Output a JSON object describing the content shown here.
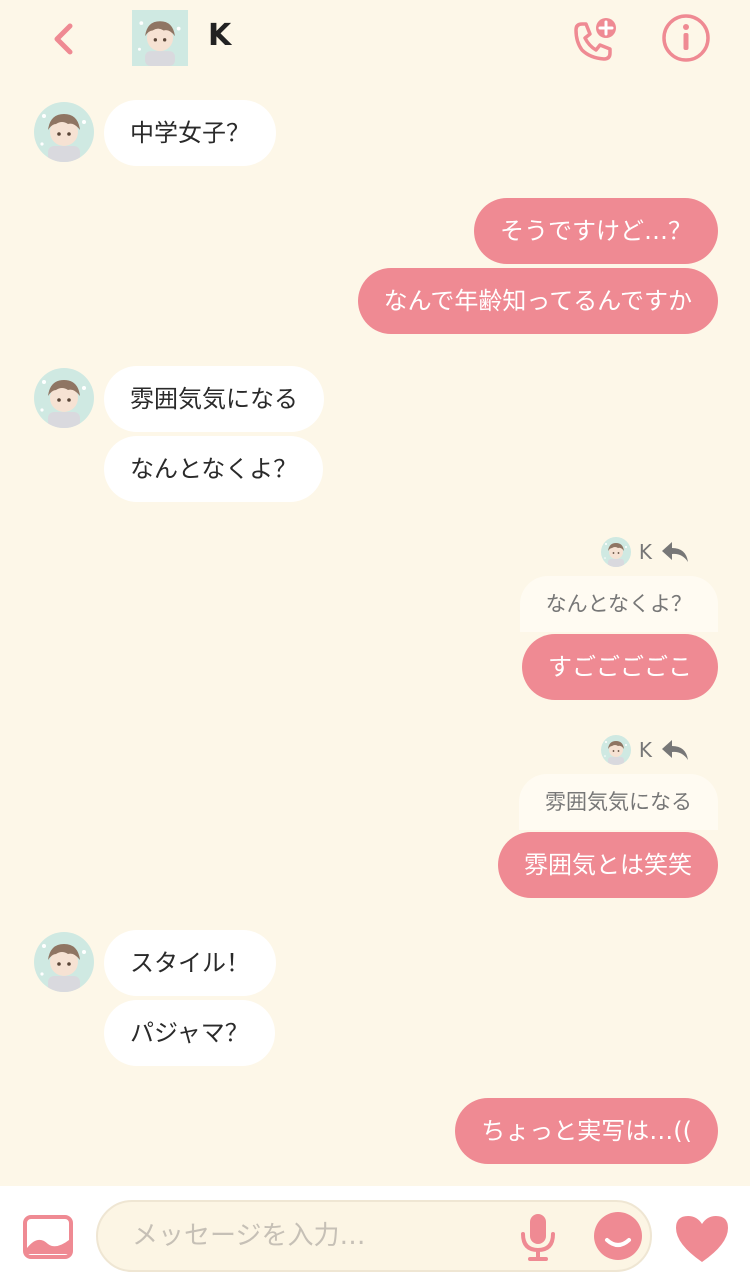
{
  "header": {
    "contact_name": "K",
    "accent_color": "#ef8a93"
  },
  "messages": [
    {
      "side": "in",
      "text": "中学女子？"
    },
    {
      "side": "out",
      "text": "そうですけど…？"
    },
    {
      "side": "out",
      "text": "なんで年齢知ってるんですか"
    },
    {
      "side": "in",
      "text": "雰囲気気になる"
    },
    {
      "side": "in",
      "text": "なんとなくよ？"
    },
    {
      "side": "out",
      "reply_to": "K",
      "quote": "なんとなくよ？",
      "text": "すごごごごこ"
    },
    {
      "side": "out",
      "reply_to": "K",
      "quote": "雰囲気気になる",
      "text": "雰囲気とは笑笑"
    },
    {
      "side": "in",
      "text": "スタイル！"
    },
    {
      "side": "in",
      "text": "パジャマ？"
    },
    {
      "side": "out",
      "text": "ちょっと実写は…(("
    }
  ],
  "composer": {
    "placeholder": "メッセージを入力…"
  },
  "icons": {
    "back": "chevron-left-icon",
    "call": "phone-add-icon",
    "info": "info-icon",
    "gallery": "image-icon",
    "mic": "microphone-icon",
    "emoji": "smiley-icon",
    "heart": "heart-icon"
  }
}
